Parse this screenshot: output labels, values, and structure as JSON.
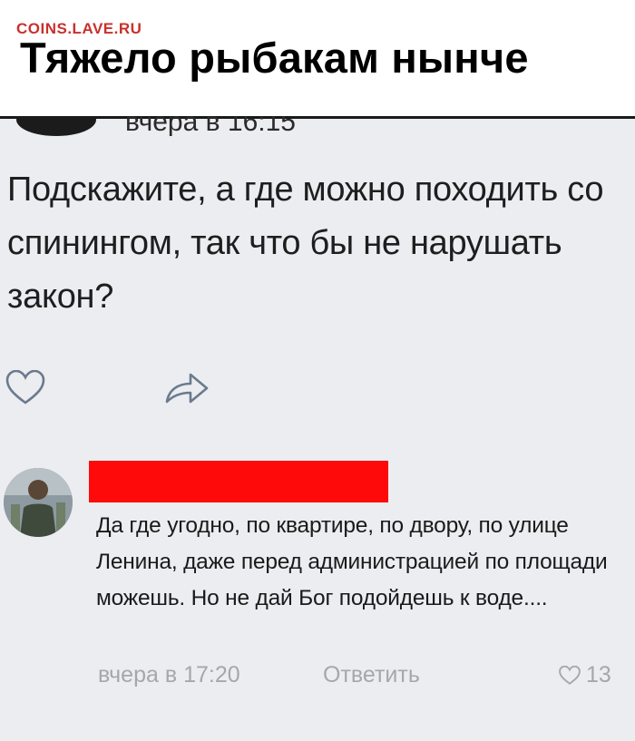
{
  "meme": {
    "watermark": "COINS.LAVE.RU",
    "title": "Тяжело рыбакам нынче"
  },
  "post": {
    "time": "вчера в 16:15",
    "text": "Подскажите, а где можно походить со спинингом, так что бы не нарушать закон?",
    "actions": {
      "like_icon": "heart-icon",
      "share_icon": "share-arrow-icon"
    }
  },
  "comment": {
    "redaction_color": "#ff0a0a",
    "text": "Да где угодно, по квартире, по двору, по улице Ленина, даже перед администрацией по площади можешь. Но не дай Бог подойдешь к воде....",
    "time": "вчера в 17:20",
    "reply_label": "Ответить",
    "likes": "13",
    "like_icon": "heart-icon"
  },
  "colors": {
    "screen_bg": "#ecedf0",
    "meta_gray": "#a5a7ad",
    "watermark_red": "#c9302c"
  }
}
